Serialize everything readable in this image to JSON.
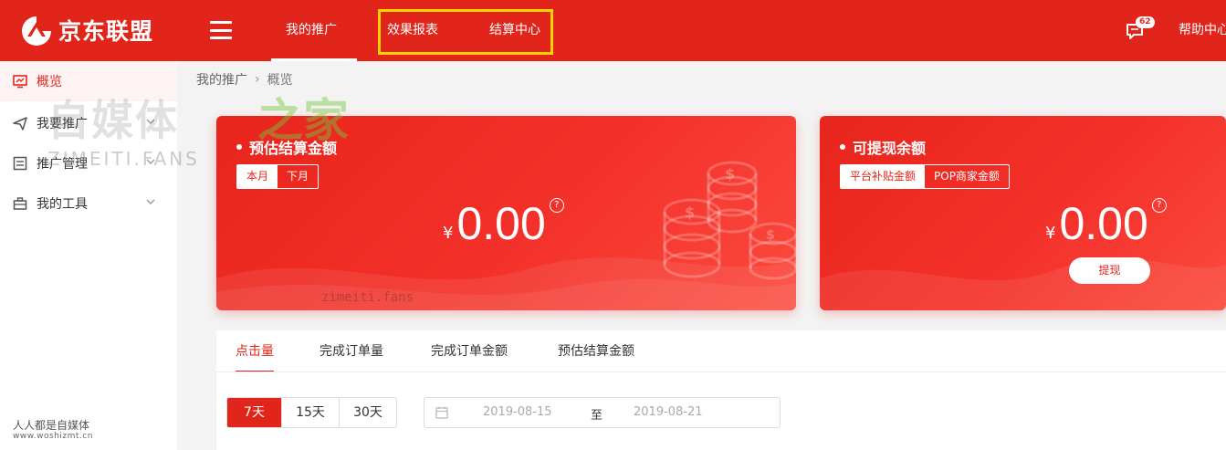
{
  "header": {
    "logo_text": "京东联盟",
    "nav": [
      "我的推广",
      "效果报表",
      "结算中心"
    ],
    "message_badge": "62",
    "help": "帮助中心"
  },
  "sidebar": {
    "items": [
      {
        "label": "概览",
        "icon": "monitor-icon"
      },
      {
        "label": "我要推广",
        "icon": "send-icon"
      },
      {
        "label": "推广管理",
        "icon": "list-icon"
      },
      {
        "label": "我的工具",
        "icon": "toolbox-icon"
      }
    ],
    "footer_text": "人人都是自媒体",
    "footer_url": "www.woshizmt.cn"
  },
  "breadcrumb": {
    "parent": "我的推广",
    "current": "概览"
  },
  "watermark": {
    "big": "自媒体",
    "green": "之家",
    "sub": "ZIMEITI.FANS",
    "small": "zimeiti.fans"
  },
  "cards": {
    "estimated": {
      "title": "预估结算金额",
      "tabs": [
        "本月",
        "下月"
      ],
      "currency": "¥",
      "amount": "0.00",
      "help": "?"
    },
    "withdrawable": {
      "title": "可提现余额",
      "tabs": [
        "平台补贴金额",
        "POP商家金额"
      ],
      "currency": "¥",
      "amount": "0.00",
      "help": "?",
      "action": "提现"
    }
  },
  "metrics": {
    "tabs": [
      "点击量",
      "完成订单量",
      "完成订单金额",
      "预估结算金额"
    ],
    "ranges": [
      "7天",
      "15天",
      "30天"
    ],
    "date_start": "2019-08-15",
    "date_to": "至",
    "date_end": "2019-08-21"
  },
  "colors": {
    "brand": "#e1251b",
    "highlight": "#ffd400"
  }
}
